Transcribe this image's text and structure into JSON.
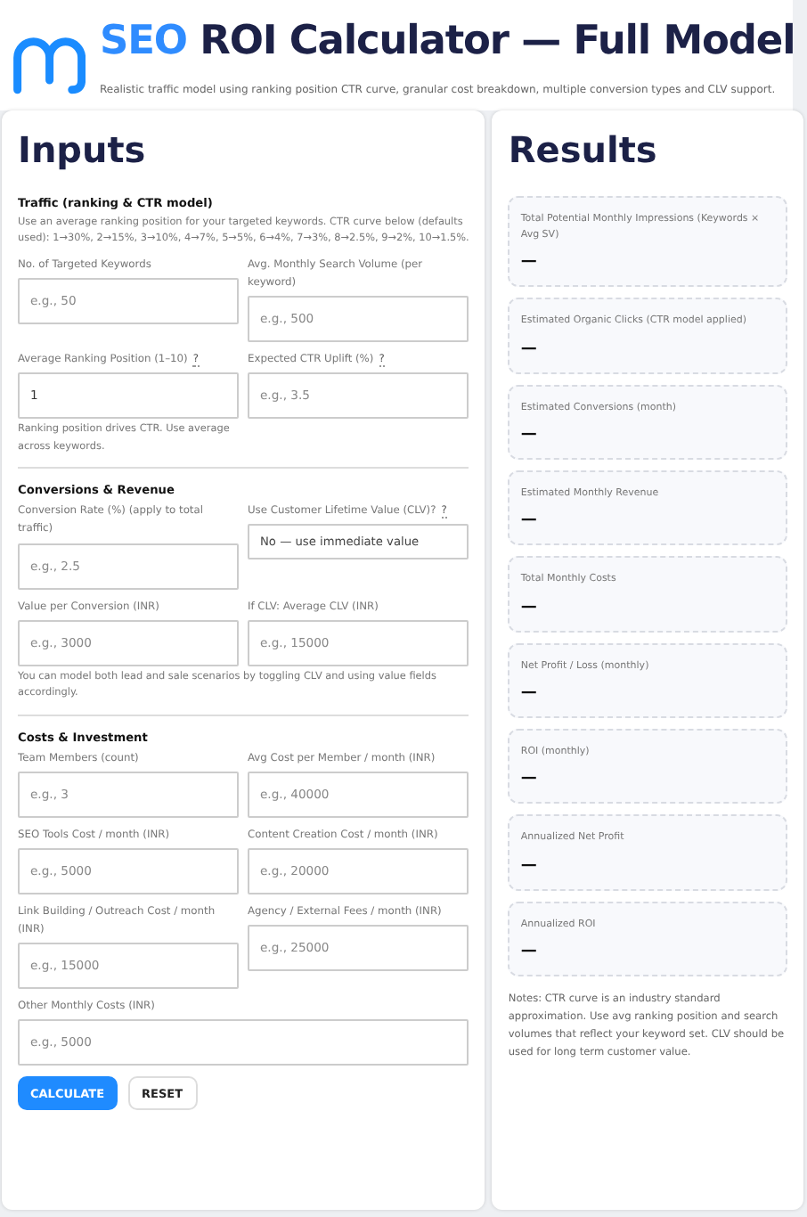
{
  "header": {
    "title_accent": "SEO",
    "title": "ROI Calculator — Full Model",
    "subtitle": "Realistic traffic model using ranking position CTR curve, granular cost breakdown, multiple conversion types and CLV support."
  },
  "inputs": {
    "title": "Inputs",
    "sections": [
      {
        "title": "Traffic (ranking & CTR model)",
        "description": "Use an average ranking position for your targeted keywords. CTR curve below (defaults used): 1→30%, 2→15%, 3→10%, 4→7%, 5→5%, 6→4%, 7→3%, 8→2.5%, 9→2%, 10→1.5%.",
        "fields": [
          {
            "kind": "input",
            "label": "No. of Targeted Keywords",
            "placeholder": "e.g., 50"
          },
          {
            "kind": "input",
            "label": "Avg. Monthly Search Volume (per keyword)",
            "placeholder": "e.g., 500"
          },
          {
            "kind": "input",
            "label": "Average Ranking Position (1–10)",
            "help": "?",
            "value": "1",
            "hint": "Ranking position drives CTR. Use average across keywords."
          },
          {
            "kind": "input",
            "label": "Expected CTR Uplift (%)",
            "help": "?",
            "placeholder": "e.g., 3.5"
          }
        ]
      },
      {
        "title": "Conversions & Revenue",
        "fields": [
          {
            "kind": "input",
            "label": "Conversion Rate (%) (apply to total traffic)",
            "placeholder": "e.g., 2.5"
          },
          {
            "kind": "select",
            "label": "Use Customer Lifetime Value (CLV)?",
            "help": "?",
            "value": "No — use immediate value"
          },
          {
            "kind": "input",
            "label": "Value per Conversion (INR)",
            "placeholder": "e.g., 3000"
          },
          {
            "kind": "input",
            "label": "If CLV: Average CLV (INR)",
            "placeholder": "e.g., 15000"
          }
        ],
        "note": "You can model both lead and sale scenarios by toggling CLV and using value fields accordingly."
      },
      {
        "title": "Costs & Investment",
        "fields": [
          {
            "kind": "input",
            "label": "Team Members (count)",
            "placeholder": "e.g., 3"
          },
          {
            "kind": "input",
            "label": "Avg Cost per Member / month (INR)",
            "placeholder": "e.g., 40000"
          },
          {
            "kind": "input",
            "label": "SEO Tools Cost / month (INR)",
            "placeholder": "e.g., 5000"
          },
          {
            "kind": "input",
            "label": "Content Creation Cost / month (INR)",
            "placeholder": "e.g., 20000"
          },
          {
            "kind": "input",
            "label": "Link Building / Outreach Cost / month (INR)",
            "placeholder": "e.g., 15000"
          },
          {
            "kind": "input",
            "label": "Agency / External Fees / month (INR)",
            "placeholder": "e.g., 25000"
          },
          {
            "kind": "input",
            "label": "Other Monthly Costs (INR)",
            "placeholder": "e.g., 5000",
            "wide": true
          }
        ]
      }
    ],
    "buttons": [
      {
        "label": "CALCULATE",
        "kind": "primary"
      },
      {
        "label": "RESET",
        "kind": "secondary"
      }
    ]
  },
  "results": {
    "title": "Results",
    "items": [
      {
        "label": "Total Potential Monthly Impressions (Keywords × Avg SV)",
        "value": "—"
      },
      {
        "label": "Estimated Organic Clicks (CTR model applied)",
        "value": "—"
      },
      {
        "label": "Estimated Conversions (month)",
        "value": "—"
      },
      {
        "label": "Estimated Monthly Revenue",
        "value": "—"
      },
      {
        "label": "Total Monthly Costs",
        "value": "—"
      },
      {
        "label": "Net Profit / Loss (monthly)",
        "value": "—"
      },
      {
        "label": "ROI (monthly)",
        "value": "—"
      },
      {
        "label": "Annualized Net Profit",
        "value": "—"
      },
      {
        "label": "Annualized ROI",
        "value": "—"
      }
    ],
    "notes": "Notes: CTR curve is an industry standard approximation. Use avg ranking position and search volumes that reflect your keyword set. CLV should be used for long term customer value."
  }
}
